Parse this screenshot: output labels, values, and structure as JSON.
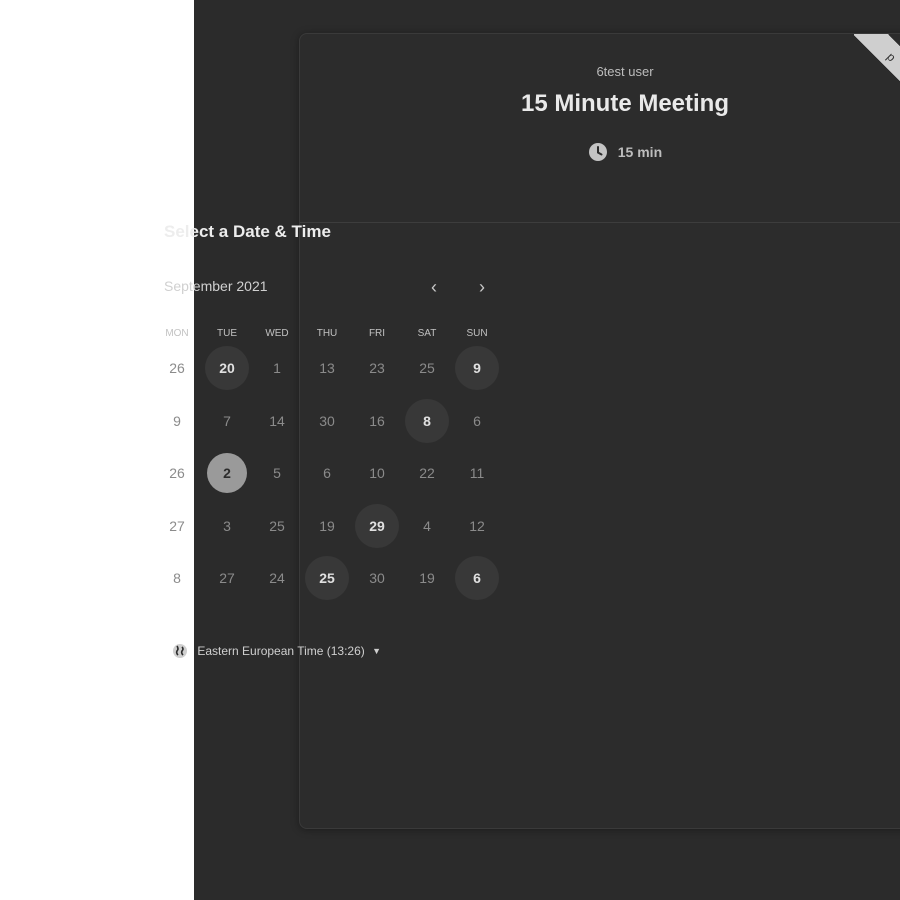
{
  "header": {
    "owner_name": "6test user",
    "event_title": "15 Minute Meeting",
    "duration": "15 min",
    "duration_icon": "clock-icon"
  },
  "ribbon": {
    "text": "p"
  },
  "picker": {
    "title": "Select a Date & Time",
    "month_label": "September 2021",
    "prev_icon": "chevron-left-icon",
    "next_icon": "chevron-right-icon",
    "weekdays": [
      "MON",
      "TUE",
      "WED",
      "THU",
      "FRI",
      "SAT",
      "SUN"
    ],
    "weeks": [
      [
        {
          "label": "26",
          "state": "disabled"
        },
        {
          "label": "20",
          "state": "available"
        },
        {
          "label": "1",
          "state": "disabled"
        },
        {
          "label": "13",
          "state": "disabled"
        },
        {
          "label": "23",
          "state": "disabled"
        },
        {
          "label": "25",
          "state": "disabled"
        },
        {
          "label": "9",
          "state": "available"
        }
      ],
      [
        {
          "label": "9",
          "state": "disabled"
        },
        {
          "label": "7",
          "state": "disabled"
        },
        {
          "label": "14",
          "state": "disabled"
        },
        {
          "label": "30",
          "state": "disabled"
        },
        {
          "label": "16",
          "state": "disabled"
        },
        {
          "label": "8",
          "state": "available"
        },
        {
          "label": "6",
          "state": "disabled"
        }
      ],
      [
        {
          "label": "26",
          "state": "disabled"
        },
        {
          "label": "2",
          "state": "selected"
        },
        {
          "label": "5",
          "state": "disabled"
        },
        {
          "label": "6",
          "state": "disabled"
        },
        {
          "label": "10",
          "state": "disabled"
        },
        {
          "label": "22",
          "state": "disabled"
        },
        {
          "label": "11",
          "state": "disabled"
        }
      ],
      [
        {
          "label": "27",
          "state": "disabled"
        },
        {
          "label": "3",
          "state": "disabled"
        },
        {
          "label": "25",
          "state": "disabled"
        },
        {
          "label": "19",
          "state": "disabled"
        },
        {
          "label": "29",
          "state": "available"
        },
        {
          "label": "4",
          "state": "disabled"
        },
        {
          "label": "12",
          "state": "disabled"
        }
      ],
      [
        {
          "label": "8",
          "state": "disabled"
        },
        {
          "label": "27",
          "state": "disabled"
        },
        {
          "label": "24",
          "state": "disabled"
        },
        {
          "label": "25",
          "state": "available"
        },
        {
          "label": "30",
          "state": "disabled"
        },
        {
          "label": "19",
          "state": "disabled"
        },
        {
          "label": "6",
          "state": "available"
        }
      ]
    ],
    "timezone": "Eastern European Time (13:26)",
    "timezone_icon": "globe-icon"
  },
  "colors": {
    "background": "#2b2b2b",
    "card": "#2c2c2c",
    "available_day": "#383838",
    "selected_day": "#9a9a9a"
  }
}
